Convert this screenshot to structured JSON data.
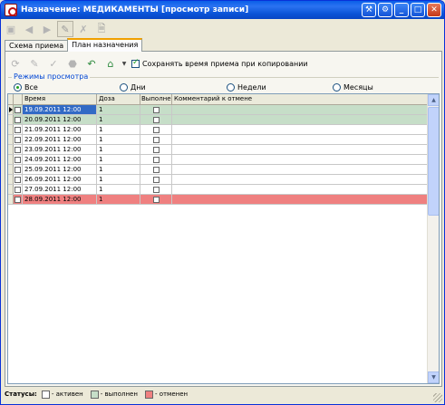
{
  "window": {
    "title": "Назначение: МЕДИКАМЕНТЫ [просмотр записи]"
  },
  "title_buttons": [
    "wrench-icon",
    "gear-icon",
    "minimize-icon",
    "maximize-icon",
    "close-icon"
  ],
  "tabs": [
    {
      "label": "Схема приема",
      "active": false
    },
    {
      "label": "План назначения",
      "active": true
    }
  ],
  "toolbar2": {
    "save_time_label": "Сохранять время приема при копировании",
    "save_time_checked": true
  },
  "modes": {
    "legend": "Режимы просмотра",
    "options": [
      {
        "label": "Все",
        "selected": true
      },
      {
        "label": "Дни",
        "selected": false
      },
      {
        "label": "Недели",
        "selected": false
      },
      {
        "label": "Месяцы",
        "selected": false
      }
    ]
  },
  "grid": {
    "columns": [
      "Время",
      "Доза",
      "Выполнен",
      "Комментарий к отмене"
    ],
    "rows": [
      {
        "time": "19.09.2011 12:00",
        "dose": "1",
        "status": "done",
        "selected": true
      },
      {
        "time": "20.09.2011 12:00",
        "dose": "1",
        "status": "done",
        "selected": false
      },
      {
        "time": "21.09.2011 12:00",
        "dose": "1",
        "status": "active",
        "selected": false
      },
      {
        "time": "22.09.2011 12:00",
        "dose": "1",
        "status": "active",
        "selected": false
      },
      {
        "time": "23.09.2011 12:00",
        "dose": "1",
        "status": "active",
        "selected": false
      },
      {
        "time": "24.09.2011 12:00",
        "dose": "1",
        "status": "active",
        "selected": false
      },
      {
        "time": "25.09.2011 12:00",
        "dose": "1",
        "status": "active",
        "selected": false
      },
      {
        "time": "26.09.2011 12:00",
        "dose": "1",
        "status": "active",
        "selected": false
      },
      {
        "time": "27.09.2011 12:00",
        "dose": "1",
        "status": "active",
        "selected": false
      },
      {
        "time": "28.09.2011 12:00",
        "dose": "1",
        "status": "canceled",
        "selected": false
      }
    ]
  },
  "status": {
    "label": "Статусы:",
    "items": [
      {
        "label": "- активен",
        "color": "#ffffff"
      },
      {
        "label": "- выполнен",
        "color": "#c6dec8"
      },
      {
        "label": "- отменен",
        "color": "#ef8080"
      }
    ]
  }
}
